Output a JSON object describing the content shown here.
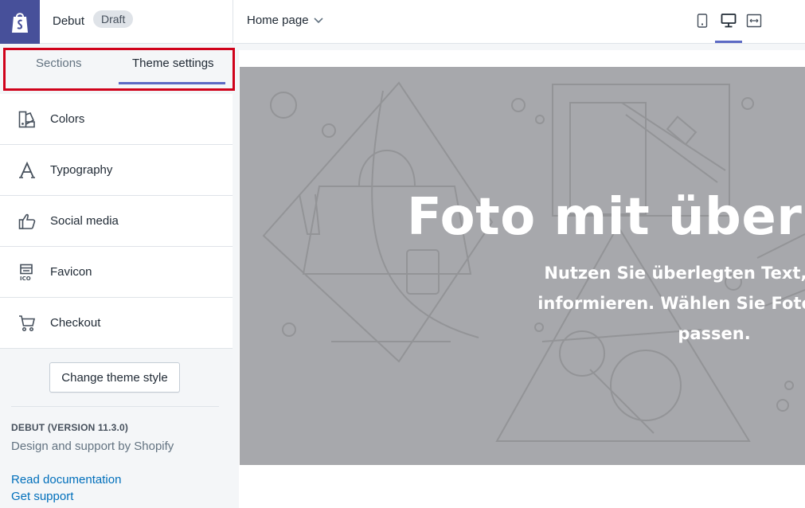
{
  "topbar": {
    "theme_name": "Debut",
    "status_badge": "Draft",
    "page_selector": "Home page"
  },
  "sidebar": {
    "tabs": [
      {
        "label": "Sections",
        "active": false
      },
      {
        "label": "Theme settings",
        "active": true
      }
    ],
    "items": [
      {
        "label": "Colors",
        "icon": "colors-icon"
      },
      {
        "label": "Typography",
        "icon": "typography-icon"
      },
      {
        "label": "Social media",
        "icon": "thumbs-up-icon"
      },
      {
        "label": "Favicon",
        "icon": "favicon-icon"
      },
      {
        "label": "Checkout",
        "icon": "cart-icon"
      }
    ],
    "footer": {
      "change_style_label": "Change theme style",
      "version": "DEBUT (VERSION 11.3.0)",
      "design_by": "Design and support by Shopify",
      "read_docs": "Read documentation",
      "get_support": "Get support"
    }
  },
  "preview": {
    "hero_title": "Foto mit überle",
    "hero_text_lines": [
      "Nutzen Sie überlegten Text, um Kun",
      "informieren. Wählen Sie Fotos und Te",
      "passen."
    ]
  },
  "colors": {
    "accent": "#5c6ac4",
    "logo_bg": "#47509a",
    "highlight": "#d0021b",
    "link": "#006fbb",
    "hero_bg": "#a7a8ac"
  }
}
